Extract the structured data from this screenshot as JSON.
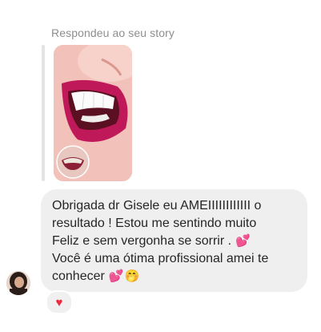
{
  "story_reply": {
    "label": "Respondeu ao seu story"
  },
  "message": {
    "line1": "Obrigada dr Gisele eu AMEIIIIIIIIIIII o",
    "line2": "resultado ! Estou me sentindo muito",
    "line3": "Feliz e sem vergonha se sorrir . ",
    "line4": "Você é uma ótima profissional amei te",
    "line5": "conhecer ",
    "emoji_hearts": "💕",
    "emoji_face": "🤭"
  },
  "reaction": {
    "emoji": "♥"
  },
  "colors": {
    "bubble": "#efefef",
    "text": "#262626",
    "label": "#8e8e8e",
    "heart": "#ed2d3f",
    "lip": "#c2185b"
  },
  "icons": {
    "reaction": "heart-icon",
    "avatar": "user-avatar"
  }
}
